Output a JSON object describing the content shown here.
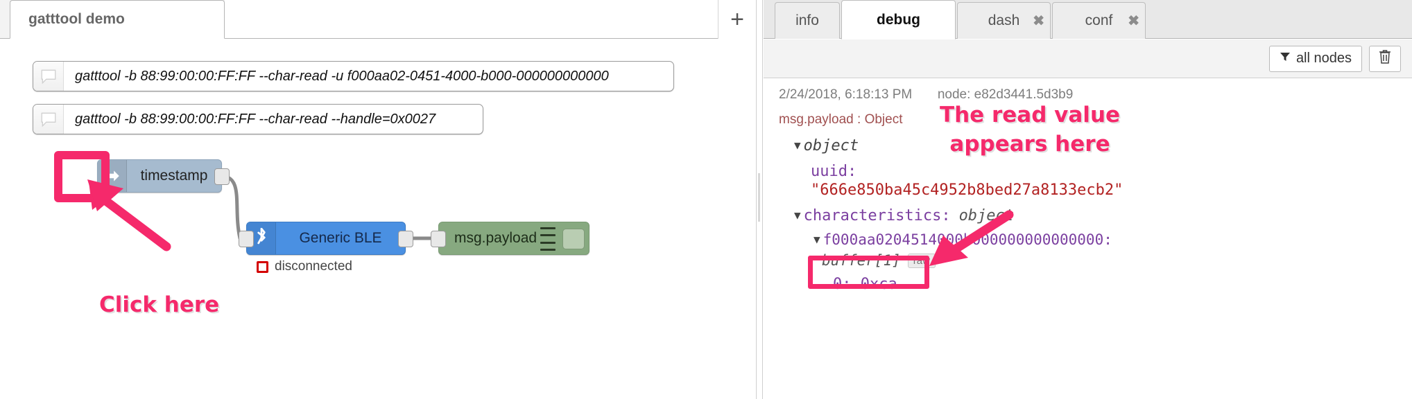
{
  "editor": {
    "flow_tabs": [
      {
        "label": "gatttool demo",
        "active": true
      }
    ],
    "add_tab_label": "+",
    "comments": [
      {
        "text": "gatttool -b 88:99:00:00:FF:FF --char-read -u f000aa02-0451-4000-b000-000000000000",
        "icon": "comment-icon"
      },
      {
        "text": "gatttool -b 88:99:00:00:FF:FF --char-read --handle=0x0027",
        "icon": "comment-icon"
      }
    ],
    "nodes": {
      "inject": {
        "label": "timestamp",
        "icon": "inject-arrow-icon",
        "color": "#a6bbcf"
      },
      "ble": {
        "label": "Generic BLE",
        "icon": "bluetooth-icon",
        "color": "#4a90e2",
        "status": "disconnected",
        "status_color": "#d40000"
      },
      "debug": {
        "label": "msg.payload",
        "icon": "debug-lines-icon",
        "color": "#87a980"
      }
    },
    "annotations": {
      "click_here": "Click here",
      "highlight_color": "#f5296b"
    }
  },
  "sidebar": {
    "tabs": [
      {
        "label": "info",
        "active": false,
        "closable": false
      },
      {
        "label": "debug",
        "active": true,
        "closable": false
      },
      {
        "label": "dash",
        "active": false,
        "closable": true
      },
      {
        "label": "conf",
        "active": false,
        "closable": true
      }
    ],
    "toolbar": {
      "filter_label": "all nodes",
      "filter_icon": "funnel-icon",
      "clear_icon": "trash-icon"
    },
    "debug_message": {
      "timestamp": "2/24/2018, 6:18:13 PM",
      "node_id": "node: e82d3441.5d3b9",
      "topic": "msg.payload : Object",
      "root_label": "object",
      "uuid_key": "uuid:",
      "uuid_value": "\"666e850ba45c4952b8bed27a8133ecb2\"",
      "characteristics_key": "characteristics:",
      "characteristics_type": "object",
      "characteristic_uuid": "f000aa0204514000b000000000000000:",
      "buffer_key": "buffer[1]",
      "raw_badge": "raw",
      "byte_entry": "0: 0xca"
    },
    "annotations": {
      "read_value": "The read value\nappears here",
      "highlight_color": "#f5296b"
    }
  }
}
